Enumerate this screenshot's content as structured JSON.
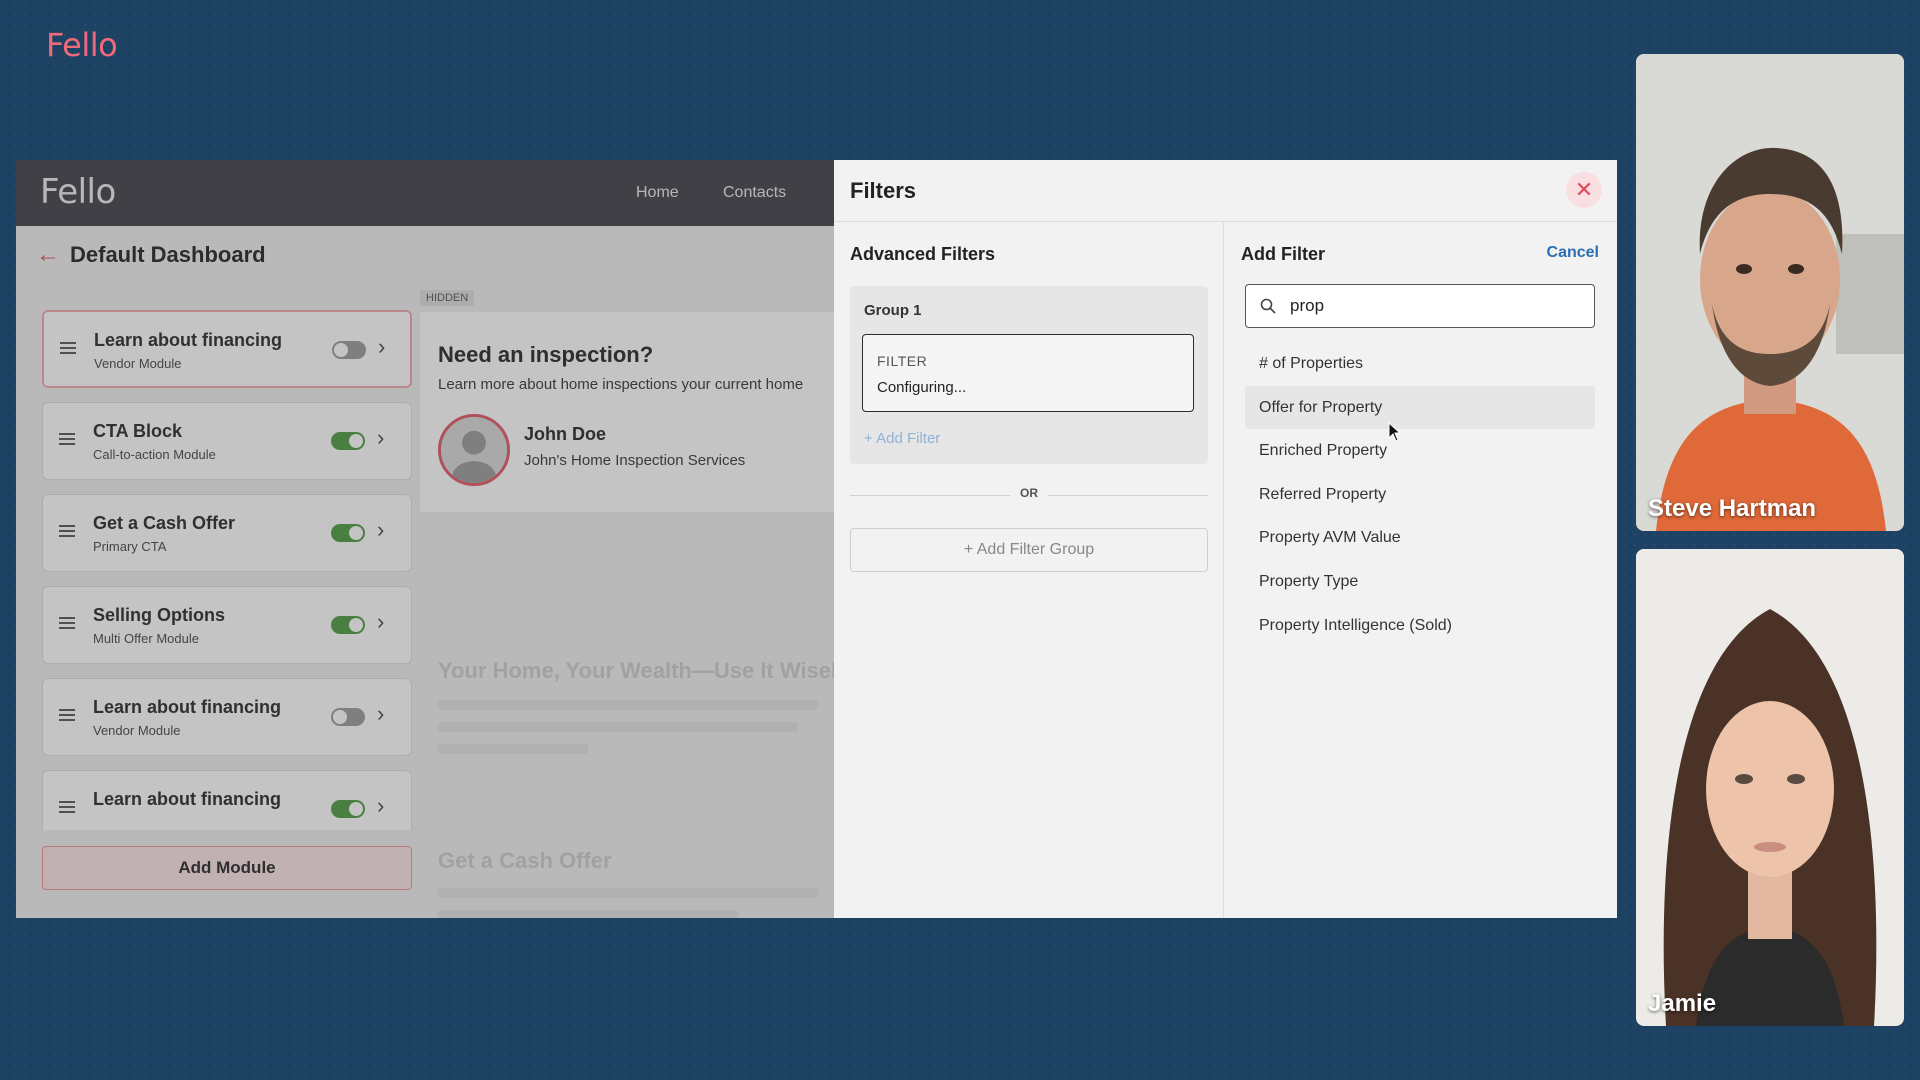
{
  "brand": {
    "logo_text": "Fello"
  },
  "app": {
    "logo_text": "Fello",
    "nav": {
      "home": "Home",
      "contacts": "Contacts"
    },
    "dashboard_title": "Default Dashboard",
    "modules": [
      {
        "title": "Learn about financing",
        "subtitle": "Vendor Module",
        "enabled": false
      },
      {
        "title": "CTA Block",
        "subtitle": "Call-to-action Module",
        "enabled": true
      },
      {
        "title": "Get a Cash Offer",
        "subtitle": "Primary CTA",
        "enabled": true
      },
      {
        "title": "Selling Options",
        "subtitle": "Multi Offer Module",
        "enabled": true
      },
      {
        "title": "Learn about financing",
        "subtitle": "Vendor Module",
        "enabled": false
      },
      {
        "title": "Learn about financing",
        "subtitle": "",
        "enabled": true
      }
    ],
    "add_module_label": "Add Module",
    "preview": {
      "hidden_tag": "HIDDEN",
      "title": "Need an inspection?",
      "subtitle": "Learn more about home inspections your current home",
      "person_name": "John Doe",
      "person_company": "John's Home Inspection Services",
      "faded_title_1": "Your Home, Your Wealth—Use It Wisely",
      "faded_title_2": "Get a Cash Offer"
    }
  },
  "filters": {
    "title": "Filters",
    "advanced": {
      "title": "Advanced Filters",
      "group_label": "Group 1",
      "filter_label": "FILTER",
      "filter_status": "Configuring...",
      "add_filter": "Add Filter",
      "or_label": "OR",
      "add_group": "Add Filter Group"
    },
    "add": {
      "title": "Add Filter",
      "cancel": "Cancel",
      "search_value": "prop",
      "options": [
        "# of Properties",
        "Offer for Property",
        "Enriched Property",
        "Referred Property",
        "Property AVM Value",
        "Property Type",
        "Property Intelligence (Sold)"
      ]
    }
  },
  "participants": [
    {
      "name": "Steve Hartman"
    },
    {
      "name": "Jamie"
    }
  ],
  "colors": {
    "accent": "#e24b5a",
    "toggle_on": "#4b9a3f",
    "link": "#2a6fb5",
    "background": "#1d4263"
  }
}
